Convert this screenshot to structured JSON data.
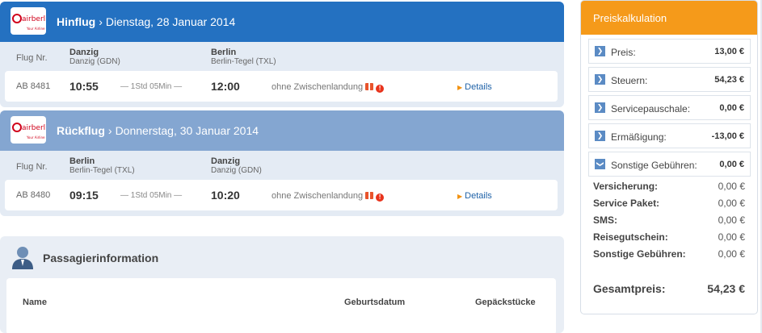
{
  "outbound": {
    "logo_text": "airberlin",
    "logo_tagline": "Your Airline",
    "direction": "Hinflug",
    "separator": "›",
    "date": "Dienstag, 28 Januar 2014",
    "col_label": "Flug Nr.",
    "from_city": "Danzig",
    "from_code": "Danzig (GDN)",
    "to_city": "Berlin",
    "to_code": "Berlin-Tegel (TXL)",
    "flight_no": "AB 8481",
    "dep_time": "10:55",
    "duration": "— 1Std 05Min —",
    "arr_time": "12:00",
    "stops": "ohne Zwischenlandung",
    "details": "Details"
  },
  "return": {
    "logo_text": "airberlin",
    "logo_tagline": "Your Airline",
    "direction": "Rückflug",
    "separator": "›",
    "date": "Donnerstag, 30 Januar 2014",
    "col_label": "Flug Nr.",
    "from_city": "Berlin",
    "from_code": "Berlin-Tegel (TXL)",
    "to_city": "Danzig",
    "to_code": "Danzig (GDN)",
    "flight_no": "AB 8480",
    "dep_time": "09:15",
    "duration": "— 1Std 05Min —",
    "arr_time": "10:20",
    "stops": "ohne Zwischenlandung",
    "details": "Details"
  },
  "passenger": {
    "title": "Passagierinformation",
    "col_name": "Name",
    "col_birth": "Geburtsdatum",
    "col_luggage": "Gepäckstücke"
  },
  "price": {
    "title": "Preiskalkulation",
    "rows": [
      {
        "label": "Preis:",
        "value": "13,00 €"
      },
      {
        "label": "Steuern:",
        "value": "54,23 €"
      },
      {
        "label": "Servicepauschale:",
        "value": "0,00 €"
      },
      {
        "label": "Ermäßigung:",
        "value": "-13,00 €"
      },
      {
        "label": "Sonstige Gebühren:",
        "value": "0,00 €"
      }
    ],
    "sub": [
      {
        "label": "Versicherung:",
        "value": "0,00 €"
      },
      {
        "label": "Service Paket:",
        "value": "0,00 €"
      },
      {
        "label": "SMS:",
        "value": "0,00 €"
      },
      {
        "label": "Reisegutschein:",
        "value": "0,00 €"
      },
      {
        "label": "Sonstige Gebühren:",
        "value": "0,00 €"
      }
    ],
    "total_label": "Gesamtpreis:",
    "total_value": "54,23 €"
  },
  "colors": {
    "outbound_header": "#2471c1",
    "return_header": "#84a6d1",
    "price_header": "#f59a1a",
    "link": "#1f62a8"
  }
}
